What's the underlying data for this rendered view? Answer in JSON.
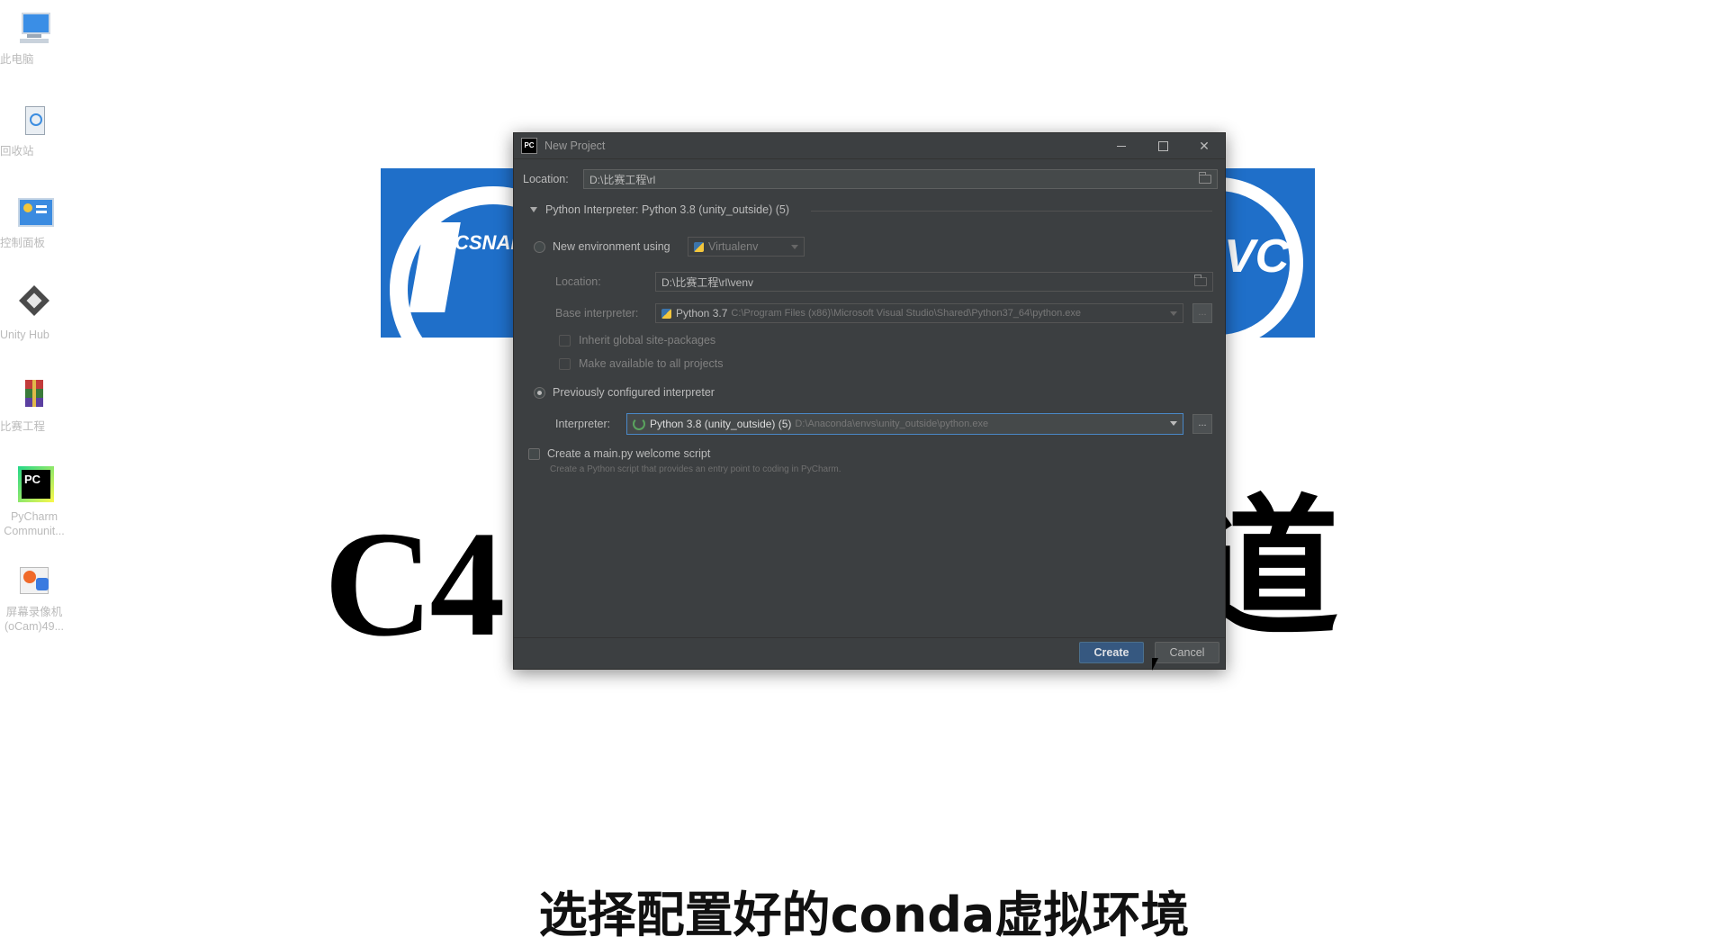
{
  "desktop": {
    "icons": [
      {
        "label": "此电脑",
        "icon": "computer-icon"
      },
      {
        "label": "回收站",
        "icon": "recycle-bin-icon"
      },
      {
        "label": "控制面板",
        "icon": "control-panel-icon"
      },
      {
        "label": "Unity Hub",
        "icon": "unity-hub-icon"
      },
      {
        "label": "比赛工程",
        "icon": "winrar-folder-icon"
      },
      {
        "label": "PyCharm Communit...",
        "icon": "pycharm-icon"
      },
      {
        "label": "屏幕录像机 (oCam)49...",
        "icon": "ocam-icon"
      }
    ]
  },
  "slide": {
    "big_left": "C4",
    "big_right": "道",
    "left_logo_text": "CSNAME",
    "right_logo_text": "VC"
  },
  "subtitle": "选择配置好的conda虚拟环境",
  "dialog": {
    "title": "New Project",
    "app_icon_text": "PC",
    "location_label": "Location:",
    "location_value": "D:\\比赛工程\\rl",
    "interpreter_section": "Python Interpreter: Python 3.8 (unity_outside) (5)",
    "new_env_label": "New environment using",
    "new_env_tool": "Virtualenv",
    "venv_location_label": "Location:",
    "venv_location_value": "D:\\比赛工程\\rl\\venv",
    "base_interpreter_label": "Base interpreter:",
    "base_interpreter_name": "Python 3.7",
    "base_interpreter_path": "C:\\Program Files (x86)\\Microsoft Visual Studio\\Shared\\Python37_64\\python.exe",
    "inherit_label": "Inherit global site-packages",
    "make_available_label": "Make available to all projects",
    "previously_configured_label": "Previously configured interpreter",
    "interpreter_label": "Interpreter:",
    "interpreter_name": "Python 3.8 (unity_outside) (5)",
    "interpreter_path": "D:\\Anaconda\\envs\\unity_outside\\python.exe",
    "welcome_script_label": "Create a main.py welcome script",
    "welcome_script_hint": "Create a Python script that provides an entry point to coding in PyCharm.",
    "dots": "...",
    "create_button": "Create",
    "cancel_button": "Cancel",
    "selected_mode": "previously_configured"
  }
}
